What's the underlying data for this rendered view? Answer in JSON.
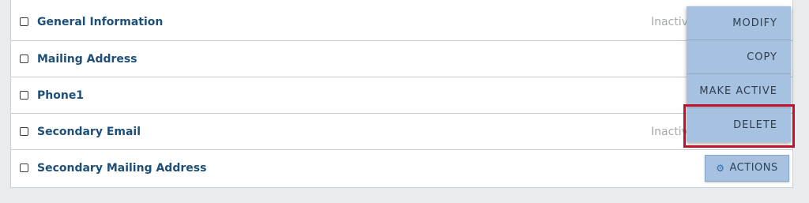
{
  "rows": [
    {
      "label": "General Information",
      "status": "Inactive"
    },
    {
      "label": "Mailing Address",
      "status": ""
    },
    {
      "label": "Phone1",
      "status": ""
    },
    {
      "label": "Secondary Email",
      "status": "Inactive"
    },
    {
      "label": "Secondary Mailing Address",
      "status": ""
    }
  ],
  "actions_button": {
    "label": "ACTIONS",
    "icon": "gear-icon"
  },
  "menu": {
    "items": [
      {
        "label": "MODIFY"
      },
      {
        "label": "COPY"
      },
      {
        "label": "MAKE ACTIVE"
      },
      {
        "label": "DELETE"
      }
    ]
  },
  "colors": {
    "label_text": "#1d4f79",
    "button_bg": "#a7c2e0",
    "highlight": "#c0112b"
  }
}
